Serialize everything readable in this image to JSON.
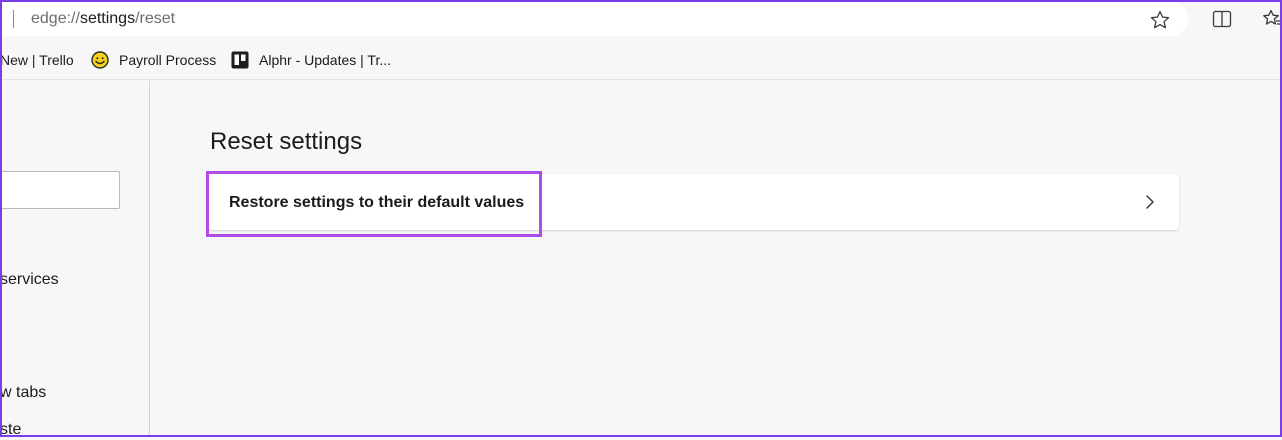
{
  "address_bar": {
    "url_prefix": "edge://",
    "url_host": "settings",
    "url_path": "/reset"
  },
  "toolbar": {
    "icons": [
      "star-icon",
      "split-screen-icon",
      "favorites-icon"
    ]
  },
  "favorites_bar": {
    "items": [
      {
        "label": "New | Trello"
      },
      {
        "label": "Payroll Process",
        "icon": "payroll-smiley-icon"
      },
      {
        "label": "Alphr - Updates | Tr...",
        "icon": "trello-board-icon"
      }
    ]
  },
  "sidebar": {
    "items": [
      {
        "label": "services"
      },
      {
        "label": "w tabs"
      },
      {
        "label": "ste"
      }
    ]
  },
  "main": {
    "section_title": "Reset settings",
    "restore_label": "Restore settings to their default values"
  },
  "colors": {
    "highlight": "#b04be8",
    "frame": "#7a3ee8",
    "background": "#f7f7f7"
  }
}
